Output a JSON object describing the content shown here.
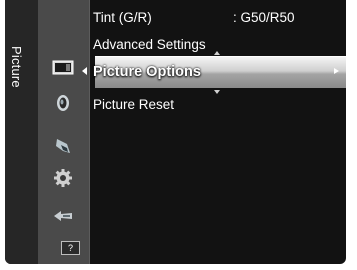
{
  "side_label": "Picture",
  "menu": {
    "items": [
      {
        "label": "Tint (G/R)",
        "value": ": G50/R50"
      },
      {
        "label": "Advanced Settings"
      },
      {
        "label": "Picture Options"
      },
      {
        "label": "Picture Reset"
      }
    ],
    "selected_index": 2
  },
  "icons": [
    "picture-icon",
    "sound-icon",
    "setup-icon",
    "settings-icon",
    "input-icon",
    "support-icon"
  ],
  "help_glyph": "?"
}
